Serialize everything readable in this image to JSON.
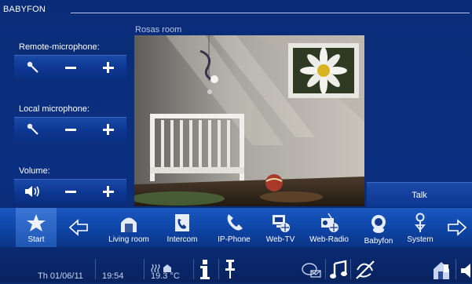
{
  "app": {
    "title": "BABYFON"
  },
  "controls": {
    "remote_mic_label": "Remote-microphone:",
    "local_mic_label": "Local microphone:",
    "volume_label": "Volume:"
  },
  "room": {
    "name": "Rosas room"
  },
  "talk_label": "Talk",
  "nav": {
    "items": [
      {
        "label": "Start"
      },
      {
        "label": "Living room"
      },
      {
        "label": "Intercom"
      },
      {
        "label": "IP-Phone"
      },
      {
        "label": "Web-TV"
      },
      {
        "label": "Web-Radio"
      },
      {
        "label": "Babyfon"
      },
      {
        "label": "System"
      }
    ]
  },
  "status": {
    "date": "Th 01/06/11",
    "time": "19:54",
    "temperature": "19.3 °C"
  },
  "colors": {
    "background": "#0b2f80",
    "accent": "#1a58c0"
  }
}
